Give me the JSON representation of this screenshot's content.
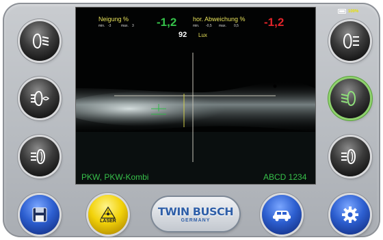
{
  "battery": {
    "level_label": "100%"
  },
  "readouts": {
    "neigung": {
      "label": "Neigung %",
      "value": "-1,2",
      "min_label": "min.",
      "min": "-3",
      "max_label": "max.",
      "max": "3"
    },
    "abweichung": {
      "label": "hor. Abweichung %",
      "value": "-1,2",
      "min_label": "min.",
      "min": "-0,5",
      "max_label": "max.",
      "max": "0,5"
    },
    "lux": {
      "value": "92",
      "unit": "Lux"
    }
  },
  "status": {
    "vehicle_type": "PKW, PKW-Kombi",
    "plate": "ABCD 1234"
  },
  "buttons": {
    "left": [
      "low-beam",
      "fog-light-front",
      "fog-light-rear"
    ],
    "right": [
      "low-beam-right",
      "low-beam-active",
      "fog-light-rear-right"
    ],
    "bottom": {
      "save": "save",
      "laser_label": "LASER",
      "vehicle": "vehicle",
      "settings": "settings"
    }
  },
  "logo": {
    "name": "TWIN BUSCH",
    "sub": "GERMANY"
  },
  "colors": {
    "accent_green": "#35c24a",
    "accent_red": "#e0242a",
    "active_ring": "#8fd16e"
  }
}
